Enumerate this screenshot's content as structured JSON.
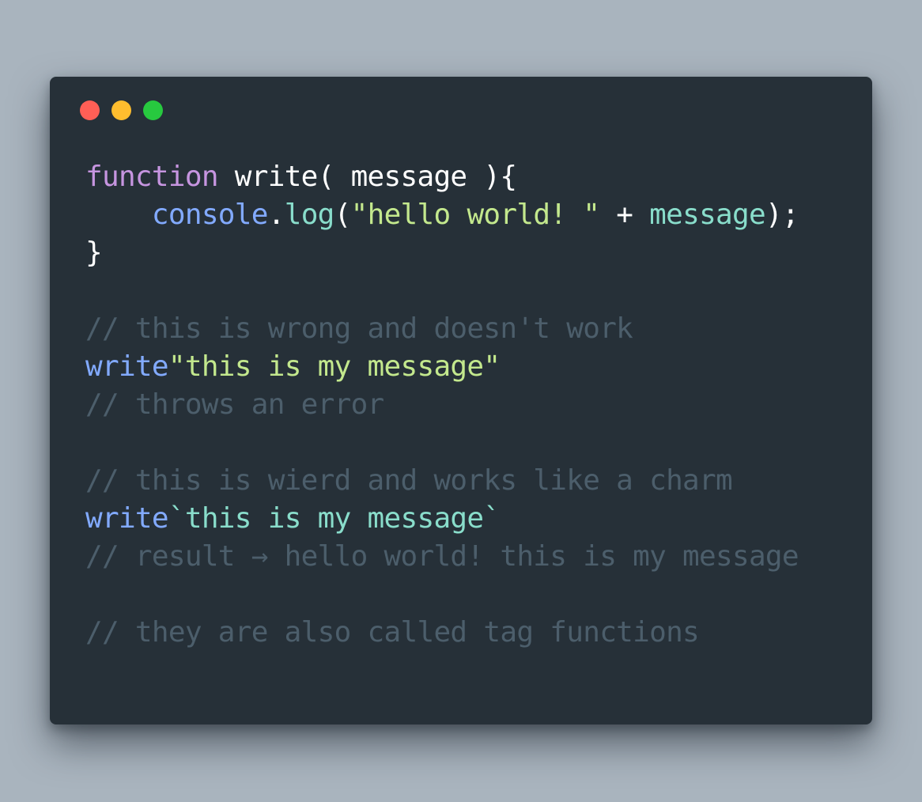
{
  "colors": {
    "background": "#a9b4be",
    "window": "#263038",
    "dot_close": "#ff5f56",
    "dot_minimize": "#ffbd2e",
    "dot_maximize": "#27c93f"
  },
  "window_controls": [
    {
      "icon": "close-dot-icon",
      "color": "#ff5f56"
    },
    {
      "icon": "minimize-dot-icon",
      "color": "#ffbd2e"
    },
    {
      "icon": "maximize-dot-icon",
      "color": "#27c93f"
    }
  ],
  "code_lines": [
    [
      {
        "type": "keyword",
        "text": "function"
      },
      {
        "type": "plain",
        "text": " write( message ){"
      }
    ],
    [
      {
        "type": "plain",
        "text": "    "
      },
      {
        "type": "fn",
        "text": "console"
      },
      {
        "type": "plain",
        "text": "."
      },
      {
        "type": "method",
        "text": "log"
      },
      {
        "type": "plain",
        "text": "("
      },
      {
        "type": "string",
        "text": "\"hello world! \""
      },
      {
        "type": "plain",
        "text": " + "
      },
      {
        "type": "method",
        "text": "message"
      },
      {
        "type": "plain",
        "text": ");"
      }
    ],
    [
      {
        "type": "plain",
        "text": "}"
      }
    ],
    [],
    [
      {
        "type": "comment",
        "text": "// this is wrong and doesn't work"
      }
    ],
    [
      {
        "type": "fn",
        "text": "write"
      },
      {
        "type": "string",
        "text": "\"this is my message\""
      }
    ],
    [
      {
        "type": "comment",
        "text": "// throws an error"
      }
    ],
    [],
    [
      {
        "type": "comment",
        "text": "// this is wierd and works like a charm"
      }
    ],
    [
      {
        "type": "fn",
        "text": "write"
      },
      {
        "type": "tmpl",
        "text": "`this is my message`"
      }
    ],
    [
      {
        "type": "comment",
        "text": "// result → hello world! this is my message"
      }
    ],
    [],
    [
      {
        "type": "comment",
        "text": "// they are also called tag functions"
      }
    ]
  ]
}
